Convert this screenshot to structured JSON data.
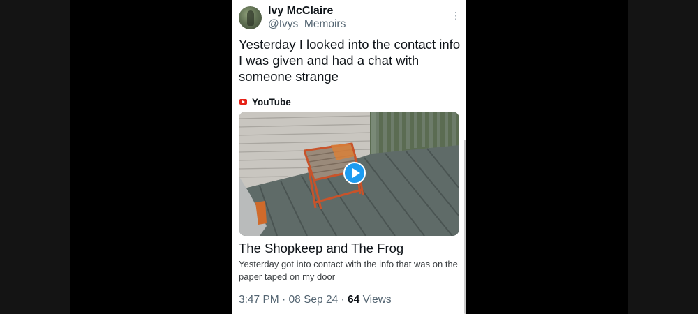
{
  "tweet": {
    "display_name": "Ivy McClaire",
    "handle": "@Ivys_Memoirs",
    "text": "Yesterday I looked into the contact info I was given and had a chat with someone strange",
    "more_icon": "more-vertical-icon"
  },
  "link_card": {
    "source": "YouTube",
    "source_icon": "youtube-icon",
    "title": "The Shopkeep and The Frog",
    "description": "Yesterday got into contact with the info that was on the paper taped on my door",
    "play_icon": "play-icon"
  },
  "meta": {
    "time": "3:47 PM",
    "separator": "·",
    "date": "08 Sep 24",
    "views_count": "64",
    "views_label": "Views"
  },
  "colors": {
    "accent": "#1d9bf0",
    "youtube_red": "#e62117",
    "text_primary": "#0f1419",
    "text_secondary": "#536471"
  }
}
